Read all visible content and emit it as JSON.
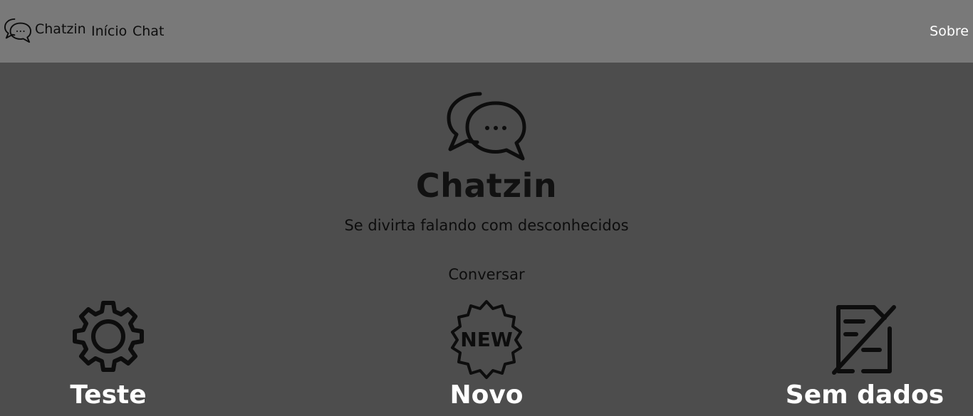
{
  "navbar": {
    "brand": "Chatzin",
    "links": [
      "Início",
      "Chat"
    ],
    "right_link": "Sobre",
    "brand_icon": "chat-bubbles-icon"
  },
  "hero": {
    "icon": "chat-bubbles-icon",
    "title": "Chatzin",
    "subtitle": "Se divirta falando com desconhecidos",
    "cta": "Conversar"
  },
  "features": [
    {
      "icon": "gear-icon",
      "label": "Teste"
    },
    {
      "icon": "new-badge-icon",
      "label": "Novo",
      "badge_text": "NEW"
    },
    {
      "icon": "no-data-document-icon",
      "label": "Sem dados"
    }
  ],
  "colors": {
    "navbar_bg": "#797979",
    "page_bg": "#4d4d4d",
    "dark_text": "#0d0d0d",
    "light_text": "#ffffff"
  }
}
